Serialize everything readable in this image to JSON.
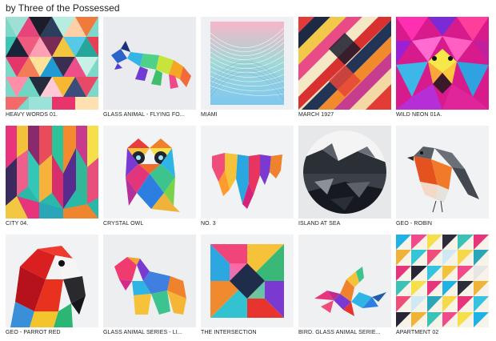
{
  "header": {
    "byline": "by Three of the Possessed"
  },
  "items": [
    {
      "caption": "HEAVY WORDS 01.",
      "art": "heavy-words-artwork"
    },
    {
      "caption": "GLASS ANIMAL - FLYING FO...",
      "art": "glass-fox-artwork"
    },
    {
      "caption": "MIAMI",
      "art": "miami-lines-artwork"
    },
    {
      "caption": "MARCH 1927",
      "art": "march-1927-artwork"
    },
    {
      "caption": "WILD NEON 01A.",
      "art": "neon-lion-artwork"
    },
    {
      "caption": "CITY 04.",
      "art": "city-04-artwork"
    },
    {
      "caption": "CRYSTAL OWL",
      "art": "crystal-owl-artwork"
    },
    {
      "caption": "NO. 3",
      "art": "no-3-artwork"
    },
    {
      "caption": "ISLAND AT SEA",
      "art": "island-at-sea-artwork"
    },
    {
      "caption": "GEO - ROBIN",
      "art": "geo-robin-artwork"
    },
    {
      "caption": "GEO - PARROT RED",
      "art": "geo-parrot-artwork"
    },
    {
      "caption": "GLASS ANIMAL SERIES - LI...",
      "art": "glass-lion-artwork"
    },
    {
      "caption": "THE INTERSECTION",
      "art": "intersection-artwork"
    },
    {
      "caption": "BIRD. GLASS ANIMAL SERIE...",
      "art": "glass-bird-artwork"
    },
    {
      "caption": "APARTMENT 02",
      "art": "apartment-02-artwork"
    }
  ]
}
